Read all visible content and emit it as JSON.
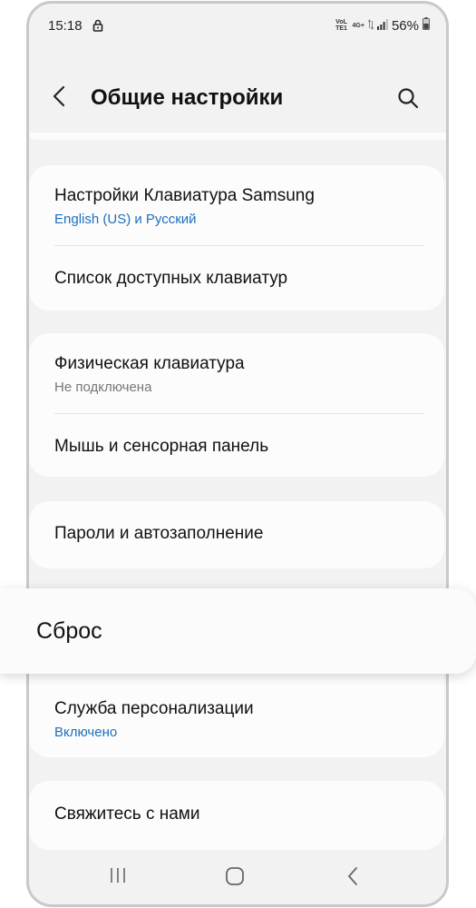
{
  "status_bar": {
    "time": "15:18",
    "volte": "VoLTE1",
    "network": "4G+",
    "battery": "56%",
    "icons": [
      "lock-icon",
      "volte-icon",
      "data-arrows-icon",
      "signal-icon",
      "battery-icon"
    ]
  },
  "header": {
    "title": "Общие настройки",
    "back_icon": "back-arrow-icon",
    "search_icon": "search-icon"
  },
  "settings": {
    "keyboard_group": {
      "samsung_keyboard": {
        "title": "Настройки Клавиатура Samsung",
        "subtitle": "English (US) и Русский"
      },
      "available_keyboards": {
        "title": "Список доступных клавиатур"
      }
    },
    "physical_group": {
      "physical_keyboard": {
        "title": "Физическая клавиатура",
        "subtitle": "Не подключена"
      },
      "mouse_touchpad": {
        "title": "Мышь и сенсорная панель"
      }
    },
    "passwords": {
      "title": "Пароли и автозаполнение"
    },
    "reset": {
      "title": "Сброс"
    },
    "personalization": {
      "title": "Служба персонализации",
      "subtitle": "Включено"
    },
    "contact": {
      "title": "Свяжитесь с нами"
    }
  },
  "nav_bar": {
    "icons": [
      "recent-apps-icon",
      "home-icon",
      "back-icon"
    ]
  },
  "colors": {
    "background": "#f2f2f2",
    "card": "#fcfcfc",
    "accent_blue": "#1f6fbf",
    "subtitle_gray": "#777777"
  }
}
